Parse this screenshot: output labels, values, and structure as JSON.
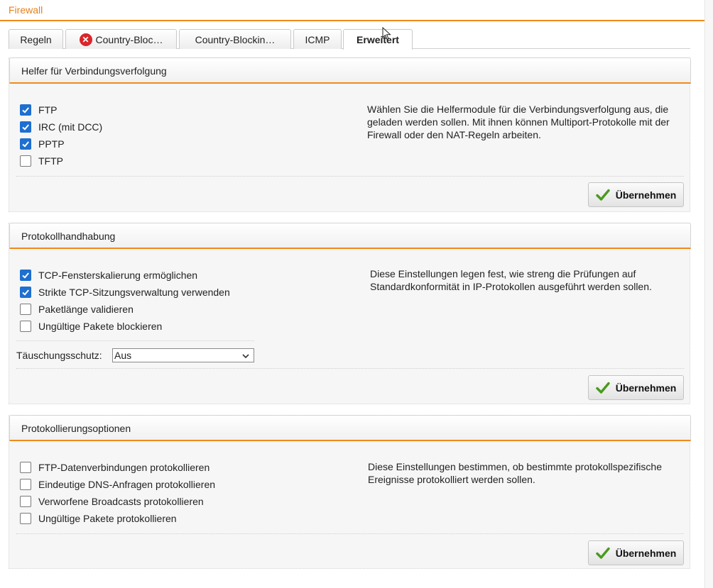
{
  "page": {
    "title": "Firewall"
  },
  "tabs": [
    {
      "label": "Regeln",
      "active": false,
      "error": false
    },
    {
      "label": "Country-Bloc…",
      "active": false,
      "error": true
    },
    {
      "label": "Country-Blockin…",
      "active": false,
      "error": false
    },
    {
      "label": "ICMP",
      "active": false,
      "error": false
    },
    {
      "label": "Erweitert",
      "active": true,
      "error": false
    }
  ],
  "panels": {
    "helpers": {
      "title": "Helfer für Verbindungsverfolgung",
      "options": [
        {
          "label": "FTP",
          "checked": true
        },
        {
          "label": "IRC (mit DCC)",
          "checked": true
        },
        {
          "label": "PPTP",
          "checked": true
        },
        {
          "label": "TFTP",
          "checked": false
        }
      ],
      "description": "Wählen Sie die Helfermodule für die Verbindungsverfolgung aus, die geladen werden sollen. Mit ihnen können Multiport-Protokolle mit der Firewall oder den NAT-Regeln arbeiten.",
      "apply_label": "Übernehmen"
    },
    "protocol": {
      "title": "Protokollhandhabung",
      "options": [
        {
          "label": "TCP-Fensterskalierung ermöglichen",
          "checked": true
        },
        {
          "label": "Strikte TCP-Sitzungsverwaltung verwenden",
          "checked": true
        },
        {
          "label": "Paketlänge validieren",
          "checked": false
        },
        {
          "label": "Ungültige Pakete blockieren",
          "checked": false
        }
      ],
      "spoof_label": "Täuschungsschutz:",
      "spoof_value": "Aus",
      "description": "Diese Einstellungen legen fest, wie streng die Prüfungen auf Standardkonformität in IP-Protokollen ausgeführt werden sollen.",
      "apply_label": "Übernehmen"
    },
    "logging": {
      "title": "Protokollierungsoptionen",
      "options": [
        {
          "label": "FTP-Datenverbindungen protokollieren",
          "checked": false
        },
        {
          "label": "Eindeutige DNS-Anfragen protokollieren",
          "checked": false
        },
        {
          "label": "Verworfene Broadcasts protokollieren",
          "checked": false
        },
        {
          "label": "Ungültige Pakete protokollieren",
          "checked": false
        }
      ],
      "description": "Diese Einstellungen bestimmen, ob bestimmte protokollspezifische Ereignisse protokolliert werden sollen.",
      "apply_label": "Übernehmen"
    }
  },
  "colors": {
    "accent": "#f08a1c",
    "checkbox": "#1e6fd0",
    "apply_check": "#4a9a1e",
    "error": "#d9262a"
  },
  "icons": {
    "apply": "checkmark-icon",
    "tab_error": "error-x-icon",
    "select": "chevron-down-icon"
  }
}
